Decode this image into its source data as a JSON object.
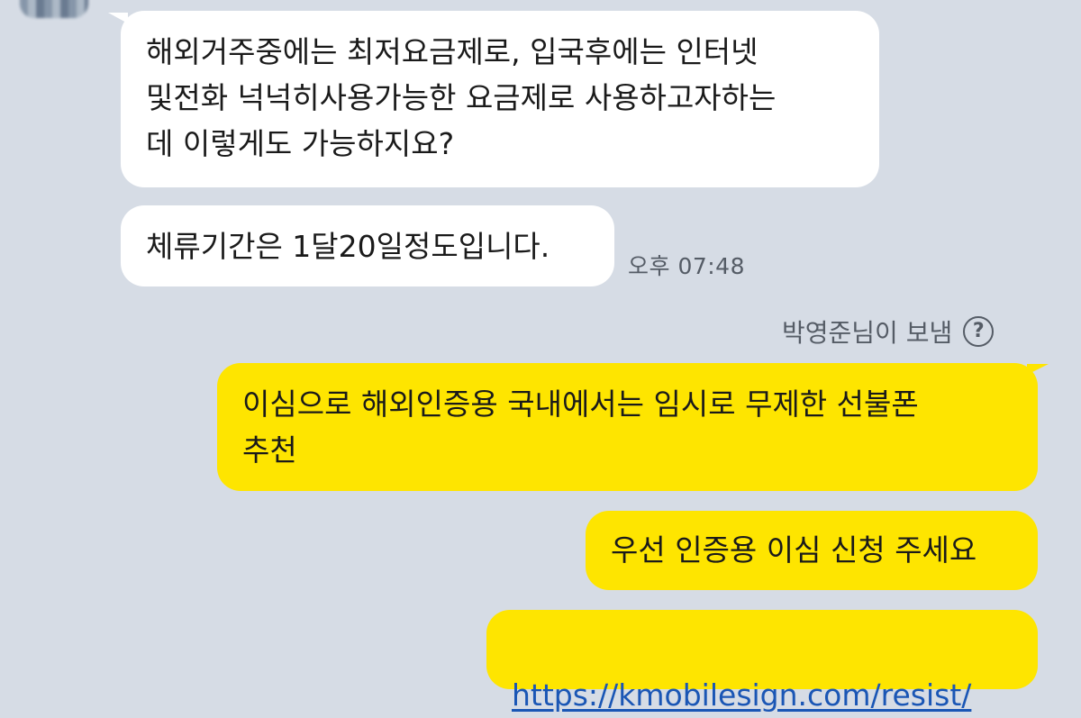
{
  "chat": {
    "incoming": [
      {
        "text": "해외거주중에는 최저요금제로, 입국후에는 인터넷\n및전화 넉넉히사용가능한 요금제로 사용하고자하는\n데 이렇게도 가능하지요?"
      },
      {
        "text": "체류기간은 1달20일정도입니다.",
        "time": "오후 07:48"
      }
    ],
    "sender_label": "박영준님이 보냄",
    "help_icon": "?",
    "outgoing": [
      {
        "text": "이심으로 해외인증용 국내에서는 임시로 무제한 선불폰\n추천"
      },
      {
        "text": "우선 인증용 이심 신청 주세요"
      },
      {
        "link": "https://kmobilesign.com/resist/"
      }
    ]
  },
  "colors": {
    "background": "#d6dce5",
    "incoming_bubble": "#ffffff",
    "outgoing_bubble": "#fee500",
    "link": "#1a56b5"
  }
}
